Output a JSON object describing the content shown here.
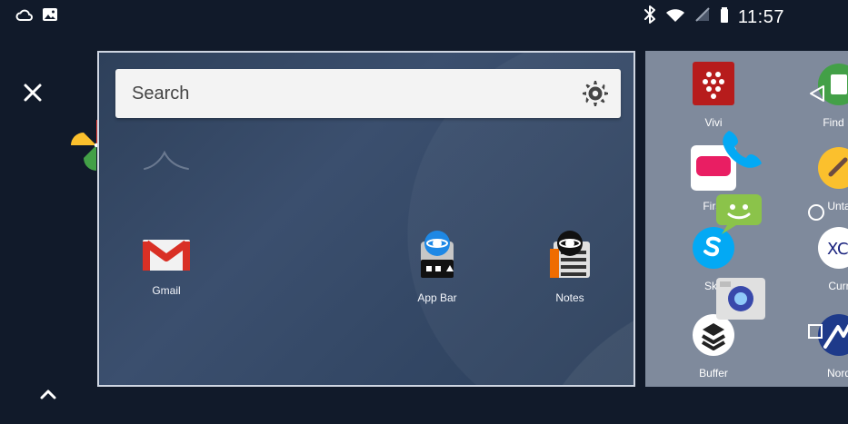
{
  "status_bar": {
    "time": "11:57"
  },
  "home": {
    "search_placeholder": "Search",
    "apps": [
      {
        "label": "Gmail"
      },
      {
        "label": "App Bar"
      },
      {
        "label": "Notes"
      }
    ]
  },
  "right_panel": {
    "apps": [
      {
        "label": "Vivi"
      },
      {
        "label": "First"
      },
      {
        "label": "Sky"
      },
      {
        "label": "Buffer"
      },
      {
        "label": "Find D"
      },
      {
        "label": "Unta"
      },
      {
        "label": "Curr"
      },
      {
        "label": "Nord"
      }
    ]
  },
  "colors": {
    "accent_red": "#e53935",
    "search_bg": "#f3f3f3",
    "card_border": "#cfd6e2"
  },
  "icons": {
    "cloud": "cloud-icon",
    "image": "image-icon",
    "bluetooth": "bluetooth-icon",
    "wifi": "wifi-icon",
    "signal": "signal-icon",
    "battery": "battery-icon",
    "close": "close-icon",
    "up": "chevron-up-icon",
    "gear": "gear-icon",
    "pinwheel": "pinwheel-icon",
    "arrow": "red-arrow-icon"
  }
}
